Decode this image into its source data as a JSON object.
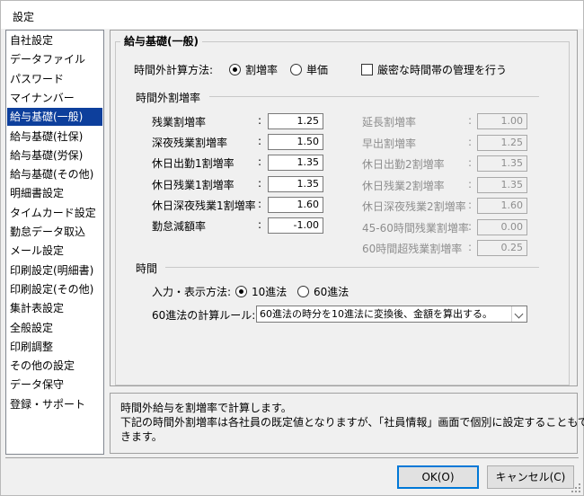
{
  "window": {
    "title": "設定"
  },
  "sidebar": {
    "items": [
      {
        "label": "自社設定"
      },
      {
        "label": "データファイル"
      },
      {
        "label": "パスワード"
      },
      {
        "label": "マイナンバー"
      },
      {
        "label": "給与基礎(一般)",
        "selected": true
      },
      {
        "label": "給与基礎(社保)"
      },
      {
        "label": "給与基礎(労保)"
      },
      {
        "label": "給与基礎(その他)"
      },
      {
        "label": "明細書設定"
      },
      {
        "label": "タイムカード設定"
      },
      {
        "label": "勤怠データ取込"
      },
      {
        "label": "メール設定"
      },
      {
        "label": "印刷設定(明細書)"
      },
      {
        "label": "印刷設定(その他)"
      },
      {
        "label": "集計表設定"
      },
      {
        "label": "全般設定"
      },
      {
        "label": "印刷調整"
      },
      {
        "label": "その他の設定"
      },
      {
        "label": "データ保守"
      },
      {
        "label": "登録・サポート"
      }
    ],
    "selected_color": "#0d3f9c"
  },
  "main": {
    "group_title": "給与基礎(一般)",
    "calc_method": {
      "label": "時間外計算方法:",
      "options": [
        "割増率",
        "単価"
      ],
      "selected": "割増率"
    },
    "strict_checkbox": {
      "label": "厳密な時間帯の管理を行う",
      "checked": false
    },
    "overtime_section": "時間外割増率",
    "left_rates": [
      {
        "label": "残業割増率",
        "value": "1.25"
      },
      {
        "label": "深夜残業割増率",
        "value": "1.50"
      },
      {
        "label": "休日出勤1割増率",
        "value": "1.35"
      },
      {
        "label": "休日残業1割増率",
        "value": "1.35"
      },
      {
        "label": "休日深夜残業1割増率",
        "value": "1.60"
      },
      {
        "label": "勤怠減額率",
        "value": "-1.00"
      }
    ],
    "right_rates": [
      {
        "label": "延長割増率",
        "value": "1.00"
      },
      {
        "label": "早出割増率",
        "value": "1.25"
      },
      {
        "label": "休日出勤2割増率",
        "value": "1.35"
      },
      {
        "label": "休日残業2割増率",
        "value": "1.35"
      },
      {
        "label": "休日深夜残業2割増率",
        "value": "1.60"
      },
      {
        "label": "45-60時間残業割増率",
        "value": "0.00"
      },
      {
        "label": "60時間超残業割増率",
        "value": "0.25"
      }
    ],
    "colon": ":",
    "time_section": "時間",
    "io_method": {
      "label": "入力・表示方法:",
      "options": [
        "10進法",
        "60進法"
      ],
      "selected": "10進法"
    },
    "rule": {
      "label": "60進法の計算ルール:",
      "value": "60進法の時分を10進法に変換後、金額を算出する。"
    }
  },
  "description": {
    "line1": "時間外給与を割増率で計算します。",
    "line2": "下記の時間外割増率は各社員の既定値となりますが、「社員情報」画面で個別に設定することもで",
    "line3": "きます。"
  },
  "buttons": {
    "ok": "OK(O)",
    "cancel": "キャンセル(C)"
  }
}
